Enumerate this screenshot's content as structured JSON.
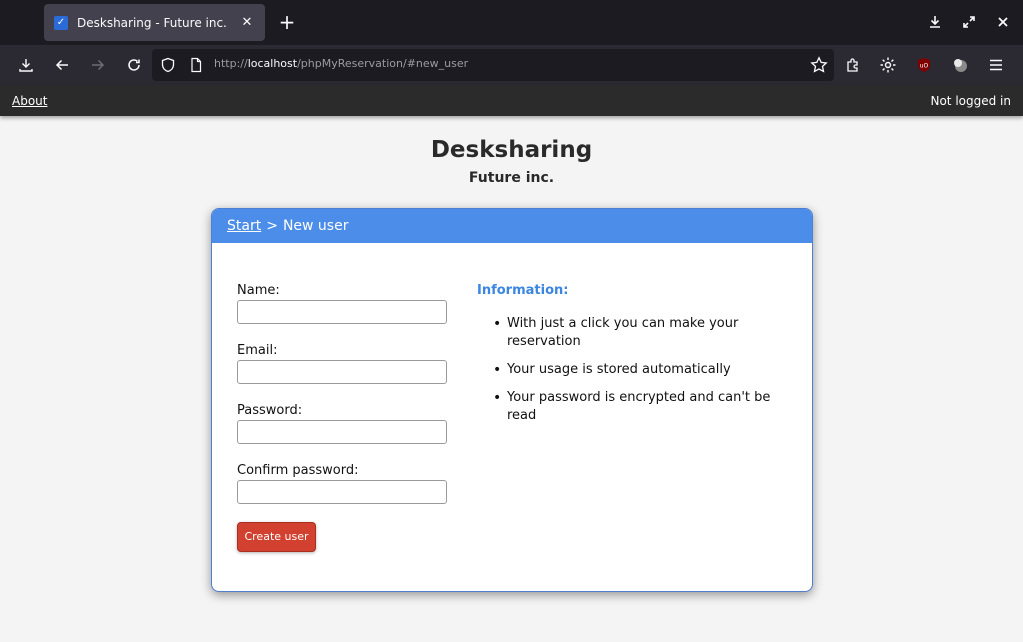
{
  "browser": {
    "tab_title": "Desksharing - Future inc.",
    "new_tab_symbol": "+",
    "url": {
      "scheme": "http://",
      "host": "localhost",
      "path": "/phpMyReservation/#new_user"
    }
  },
  "page": {
    "topbar": {
      "about_label": "About",
      "login_status": "Not logged in"
    },
    "site_title": "Desksharing",
    "site_subtitle": "Future inc.",
    "breadcrumb": {
      "start_label": "Start",
      "separator": ">",
      "current": "New user"
    },
    "form": {
      "name_label": "Name:",
      "name_value": "",
      "email_label": "Email:",
      "email_value": "",
      "password_label": "Password:",
      "password_value": "",
      "confirm_label": "Confirm password:",
      "confirm_value": "",
      "submit_label": "Create user"
    },
    "info": {
      "title": "Information:",
      "items": [
        "With just a click you can make your reservation",
        "Your usage is stored automatically",
        "Your password is encrypted and can't be read"
      ]
    }
  },
  "colors": {
    "card_header": "#4c8de9",
    "info_title": "#3b86e2",
    "submit_button": "#d2412f"
  }
}
